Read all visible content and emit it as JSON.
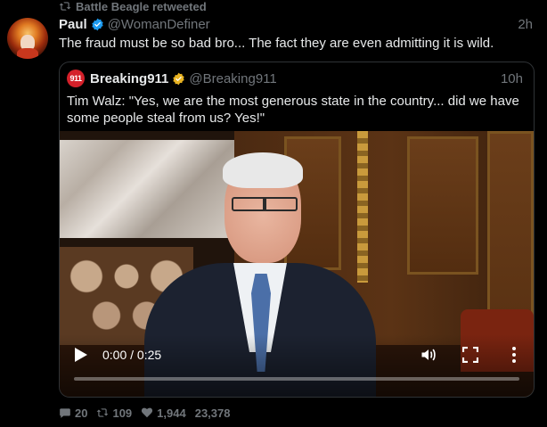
{
  "retweet": {
    "label": "Battle Beagle retweeted",
    "icon": "retweet-icon"
  },
  "tweet": {
    "name": "Paul",
    "handle": "@WomanDefiner",
    "time": "2h",
    "text": "The fraud must be so bad bro... The fact they are even admitting it is wild.",
    "verified_color": "#1d9bf0"
  },
  "quote": {
    "avatar_text": "911",
    "name": "Breaking911",
    "handle": "@Breaking911",
    "time": "10h",
    "text": "Tim Walz: \"Yes, we are the most generous state in the country... did we have some people steal from us? Yes!\"",
    "verified_color": "#e8b322",
    "video": {
      "timecode": "0:00 / 0:25",
      "progress": 0,
      "play_icon": "play-icon",
      "volume_icon": "volume-icon",
      "fullscreen_icon": "fullscreen-icon",
      "more_icon": "more-options-icon"
    }
  },
  "actions": {
    "replies": "20",
    "retweets": "109",
    "likes": "1,944",
    "views": "23,378"
  },
  "colors": {
    "background": "#000000",
    "muted": "#71767b",
    "border": "#2f3336",
    "text": "#e7e9ea"
  }
}
